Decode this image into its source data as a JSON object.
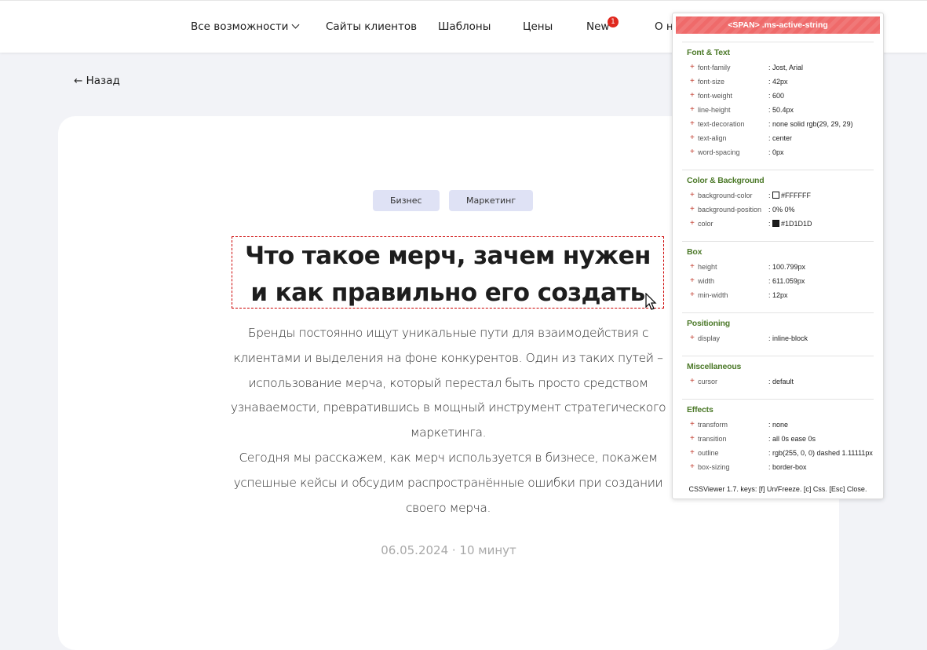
{
  "nav": {
    "features": "Все возможности",
    "clients": "Сайты клиентов",
    "templates": "Шаблоны",
    "prices": "Цены",
    "new": "New",
    "new_badge": "1",
    "about": "О н"
  },
  "back_label": "← Назад",
  "tags": [
    "Бизнес",
    "Маркетинг"
  ],
  "article": {
    "title_line1": "Что такое мерч, зачем нужен",
    "title_line2": "и как правильно его создать",
    "lead_p1": "Бренды постоянно ищут уникальные пути для взаимодействия с клиентами и выделения на фоне конкурентов. Один из таких путей – использование мерча, который перестал быть просто средством узнаваемости, превратившись в мощный инструмент стратегического маркетинга.",
    "lead_p2": "Сегодня мы расскажем, как мерч используется в бизнесе, покажем успешные кейсы и обсудим распространённые ошибки при создании своего мерча.",
    "meta": "06.05.2024 · 10 минут"
  },
  "css_viewer": {
    "header": "<SPAN> .ms-active-string",
    "sections": [
      {
        "title": "Font & Text",
        "rows": [
          {
            "name": "font-family",
            "value": ": Jost, Arial"
          },
          {
            "name": "font-size",
            "value": ": 42px"
          },
          {
            "name": "font-weight",
            "value": ": 600"
          },
          {
            "name": "line-height",
            "value": ": 50.4px"
          },
          {
            "name": "text-decoration",
            "value": ": none solid rgb(29, 29, 29)"
          },
          {
            "name": "text-align",
            "value": ": center"
          },
          {
            "name": "word-spacing",
            "value": ": 0px"
          }
        ]
      },
      {
        "title": "Color & Background",
        "rows": [
          {
            "name": "background-color",
            "value": "#FFFFFF",
            "swatch": "#ffffff"
          },
          {
            "name": "background-position",
            "value": ": 0% 0%"
          },
          {
            "name": "color",
            "value": "#1D1D1D",
            "swatch": "#1d1d1d"
          }
        ]
      },
      {
        "title": "Box",
        "rows": [
          {
            "name": "height",
            "value": ": 100.799px"
          },
          {
            "name": "width",
            "value": ": 611.059px"
          },
          {
            "name": "min-width",
            "value": ": 12px"
          }
        ]
      },
      {
        "title": "Positioning",
        "rows": [
          {
            "name": "display",
            "value": ": inline-block"
          }
        ]
      },
      {
        "title": "Miscellaneous",
        "rows": [
          {
            "name": "cursor",
            "value": ": default"
          }
        ]
      },
      {
        "title": "Effects",
        "rows": [
          {
            "name": "transform",
            "value": ": none"
          },
          {
            "name": "transition",
            "value": ": all 0s ease 0s"
          },
          {
            "name": "outline",
            "value": ": rgb(255, 0, 0) dashed 1.11111px"
          },
          {
            "name": "box-sizing",
            "value": ": border-box"
          }
        ]
      }
    ],
    "footer": "CSSViewer 1.7. keys: [f] Un/Freeze. [c] Css. [Esc] Close."
  },
  "colors": {
    "accent_badge": "#e0281e",
    "tag_bg": "#dfe2f5",
    "section_green": "#4d7a2a",
    "viewer_header": "#ef6a6a"
  }
}
